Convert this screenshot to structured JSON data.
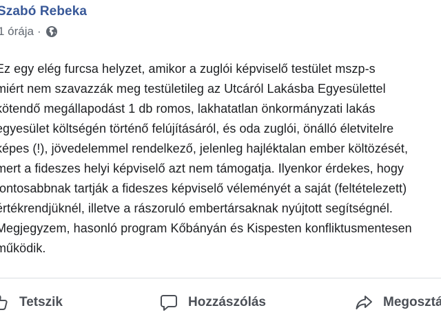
{
  "post": {
    "author": "Szabó Rebeka",
    "meta": {
      "time": "1 órája",
      "separator": "·",
      "audience_icon": "globe-icon"
    },
    "body_lines": [
      "Ez egy elég furcsa helyzet, amikor a zuglói képviselő testület mszp-s",
      "miért nem szavazzák meg testületileg az Utcáról Lakásba Egyesülettel",
      "kötendő megállapodást 1 db romos, lakhatatlan önkormányzati lakás",
      "egyesület költségén történő felújításáról, és oda zuglói, önálló életvitelre",
      "képes (!), jövedelemmel rendelkező, jelenleg hajléktalan ember költözését,",
      "mert a fideszes helyi képviselő azt nem támogatja. Ilyenkor érdekes, hogy",
      "fontosabbnak tartják a fideszes képviselő véleményét a saját (feltételezett)",
      "értékrendjüknél, illetve a rászoruló embertársaknak nyújtott segítségnél.",
      "Megjegyzem, hasonló program Kőbányán és Kispesten konfliktusmentesen",
      "működik."
    ]
  },
  "actions": {
    "like": {
      "label": "Tetszik",
      "icon": "thumbs-up-icon"
    },
    "comment": {
      "label": "Hozzászólás",
      "icon": "comment-icon"
    },
    "share": {
      "label": "Megosztás",
      "icon": "share-icon"
    }
  },
  "colors": {
    "author": "#385898",
    "meta": "#606770",
    "text": "#1c1e21",
    "action": "#4b4f56",
    "divider": "#dadde1"
  }
}
